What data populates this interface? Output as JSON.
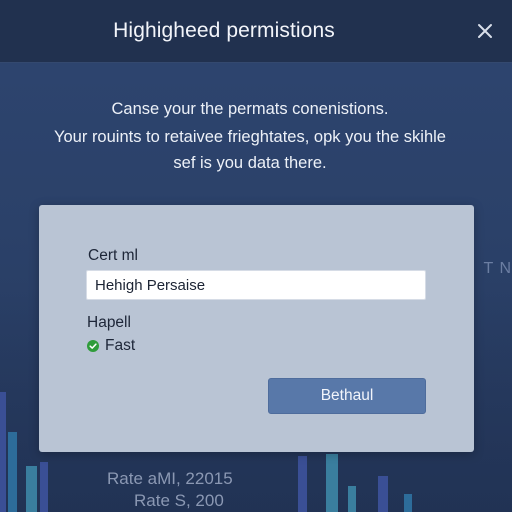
{
  "window": {
    "title": "Highigheed permistions",
    "close_icon": "close-icon"
  },
  "description": {
    "line1": "Canse your the permats conenistions.",
    "line2": "Your rouints to retaivee frieghtates, opk you the skihle",
    "line3": "sef is you data there."
  },
  "dialog": {
    "field_label": "Cert ml",
    "field_value": "Hehigh Persaise",
    "section_label": "Hapell",
    "status_text": "Fast",
    "status_icon": "check-circle-icon",
    "action_label": "Bethaul"
  },
  "background": {
    "text_line1": "Rate aMI, 22015",
    "text_line2": "Rate S, 200",
    "right_text": "T N"
  },
  "colors": {
    "accent": "#5878a9",
    "success": "#2f9c3b",
    "titlebar": "#21314f",
    "dialog": "#b9c4d4"
  }
}
